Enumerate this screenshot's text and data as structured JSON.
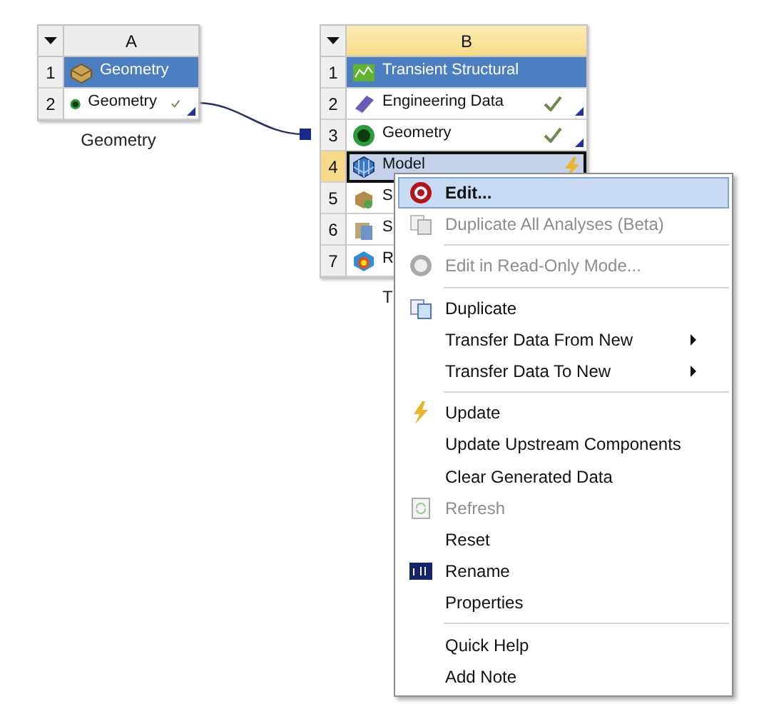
{
  "systems": [
    {
      "column": "A",
      "selected": false,
      "caption": "Geometry",
      "rows": [
        {
          "number": "1",
          "label": "Geometry",
          "kind": "title",
          "up_to_date": false,
          "update_required": false,
          "link": false,
          "selected": false
        },
        {
          "number": "2",
          "label": "Geometry",
          "kind": "cell",
          "up_to_date": true,
          "update_required": false,
          "link": true,
          "selected": false
        }
      ]
    },
    {
      "column": "B",
      "selected": true,
      "caption": "T",
      "rows": [
        {
          "number": "1",
          "label": "Transient Structural",
          "kind": "title",
          "up_to_date": false,
          "update_required": false,
          "link": false,
          "selected": false
        },
        {
          "number": "2",
          "label": "Engineering Data",
          "kind": "cell",
          "up_to_date": true,
          "update_required": false,
          "link": true,
          "selected": false
        },
        {
          "number": "3",
          "label": "Geometry",
          "kind": "cell",
          "up_to_date": true,
          "update_required": false,
          "link": true,
          "selected": false
        },
        {
          "number": "4",
          "label": "Model",
          "kind": "cell",
          "up_to_date": false,
          "update_required": true,
          "link": false,
          "selected": true
        },
        {
          "number": "5",
          "label": "S",
          "kind": "cell",
          "selected": false
        },
        {
          "number": "6",
          "label": "S",
          "kind": "cell",
          "selected": false
        },
        {
          "number": "7",
          "label": "R",
          "kind": "cell",
          "selected": false
        }
      ]
    }
  ],
  "context_menu": {
    "items": [
      {
        "kind": "item",
        "label": "Edit...",
        "default": true,
        "disabled": false,
        "selected": true,
        "submenu": false
      },
      {
        "kind": "item",
        "label": "Duplicate All Analyses (Beta)",
        "default": false,
        "disabled": true,
        "selected": false,
        "submenu": false
      },
      {
        "kind": "separator"
      },
      {
        "kind": "item",
        "label": "Edit in Read-Only Mode...",
        "default": false,
        "disabled": true,
        "selected": false,
        "submenu": false
      },
      {
        "kind": "separator"
      },
      {
        "kind": "item",
        "label": "Duplicate",
        "default": false,
        "disabled": false,
        "selected": false,
        "submenu": false
      },
      {
        "kind": "item",
        "label": "Transfer Data From New",
        "default": false,
        "disabled": false,
        "selected": false,
        "submenu": true
      },
      {
        "kind": "item",
        "label": "Transfer Data To New",
        "default": false,
        "disabled": false,
        "selected": false,
        "submenu": true
      },
      {
        "kind": "separator"
      },
      {
        "kind": "item",
        "label": "Update",
        "default": false,
        "disabled": false,
        "selected": false,
        "submenu": false
      },
      {
        "kind": "item",
        "label": "Update Upstream Components",
        "default": false,
        "disabled": false,
        "selected": false,
        "submenu": false
      },
      {
        "kind": "item",
        "label": "Clear Generated Data",
        "default": false,
        "disabled": false,
        "selected": false,
        "submenu": false
      },
      {
        "kind": "item",
        "label": "Refresh",
        "default": false,
        "disabled": true,
        "selected": false,
        "submenu": false
      },
      {
        "kind": "item",
        "label": "Reset",
        "default": false,
        "disabled": false,
        "selected": false,
        "submenu": false
      },
      {
        "kind": "item",
        "label": "Rename",
        "default": false,
        "disabled": false,
        "selected": false,
        "submenu": false
      },
      {
        "kind": "item",
        "label": "Properties",
        "default": false,
        "disabled": false,
        "selected": false,
        "submenu": false
      },
      {
        "kind": "separator"
      },
      {
        "kind": "item",
        "label": "Quick Help",
        "default": false,
        "disabled": false,
        "selected": false,
        "submenu": false
      },
      {
        "kind": "item",
        "label": "Add Note",
        "default": false,
        "disabled": false,
        "selected": false,
        "submenu": false
      }
    ]
  }
}
